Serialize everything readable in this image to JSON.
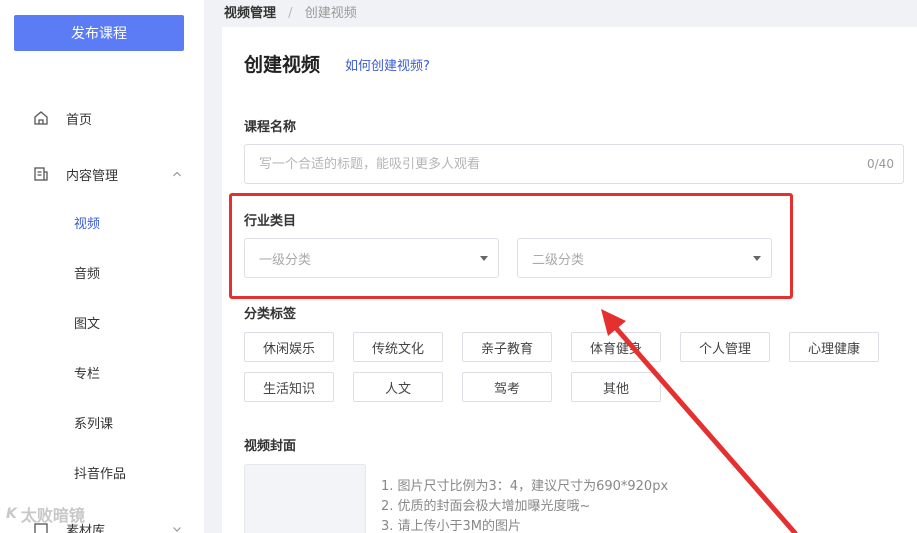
{
  "sidebar": {
    "publish_label": "发布课程",
    "items": [
      {
        "label": "首页",
        "icon": "home-icon"
      },
      {
        "label": "内容管理",
        "icon": "document-icon"
      }
    ],
    "sub_items": [
      "视频",
      "音频",
      "图文",
      "专栏",
      "系列课",
      "抖音作品"
    ],
    "last_item": {
      "label": "素材库",
      "icon": "folder-icon"
    }
  },
  "watermark": {
    "logo": "K",
    "text": "太败暗镜"
  },
  "breadcrumb": {
    "current": "视频管理",
    "separator": "/",
    "page": "创建视频"
  },
  "main": {
    "title": "创建视频",
    "help_link": "如何创建视频?",
    "course_name": {
      "label": "课程名称",
      "placeholder": "写一个合适的标题，能吸引更多人观看",
      "value": "",
      "count": "0/40"
    },
    "industry": {
      "label": "行业类目",
      "primary_placeholder": "一级分类",
      "secondary_placeholder": "二级分类"
    },
    "tags": {
      "label": "分类标签",
      "items": [
        "休闲娱乐",
        "传统文化",
        "亲子教育",
        "体育健身",
        "个人管理",
        "心理健康",
        "生活知识",
        "人文",
        "驾考",
        "其他"
      ]
    },
    "cover": {
      "label": "视频封面",
      "tips": [
        "1. 图片尺寸比例为3：4，建议尺寸为690*920px",
        "2. 优质的封面会极大增加曝光度哦~",
        "3. 请上传小于3M的图片"
      ]
    }
  },
  "colors": {
    "primary": "#5b7cf5",
    "link": "#3a5bd9",
    "annotation": "#e53030"
  }
}
